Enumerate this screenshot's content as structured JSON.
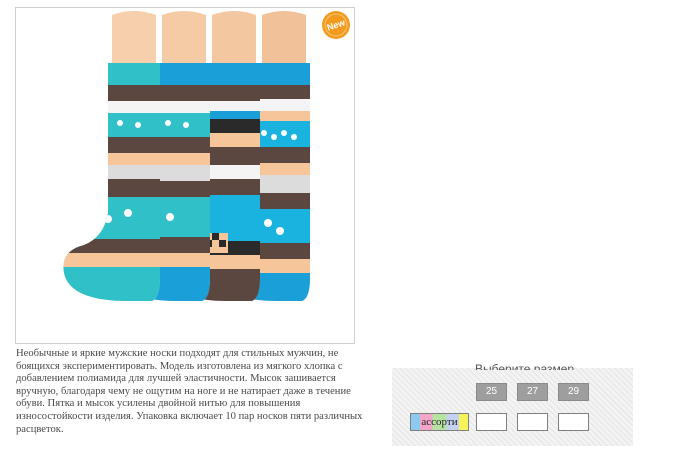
{
  "product": {
    "badge": "New",
    "image_icon": "socks-product-photo",
    "description": "Необычные и яркие мужские носки подходят для стильных мужчин, не боящихся экспериментировать. Модель изготовлена из мягкого хлопка с добавлением полиамида для лучшей эластичности. Мысок зашивается вручную, благодаря чему не ощутим на ноге и не натирает даже в течение обуви. Пятка и мысок усилены двойной нитью для повышения износостойкости изделия. Упаковка включает 10 пар носков пяти различных расцветок."
  },
  "options": {
    "heading": "Выберите размер",
    "sizes": [
      "25",
      "27",
      "29"
    ],
    "color_label": "ассорти"
  },
  "colors": {
    "badge": "#f39a1f",
    "size_button": "#9e9e9e"
  }
}
